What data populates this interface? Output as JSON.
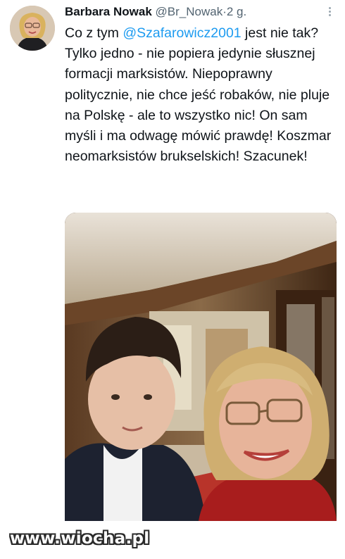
{
  "tweet": {
    "author_name": "Barbara Nowak",
    "handle": "@Br_Nowak",
    "separator": "·",
    "time": "2 g.",
    "text_prefix": "Co z tym ",
    "mention": "@Szafarowicz2001",
    "text_suffix": " jest nie tak? Tylko jedno - nie popiera jedynie słusznej formacji marksistów. Niepoprawny politycznie, nie chce jeść robaków, nie pluje na Polskę - ale to wszystko nic! On sam myśli i ma odwagę mówić prawdę! Koszmar neomarksistów brukselskich! Szacunek!"
  },
  "icons": {
    "more": "more-options-icon"
  },
  "watermark": "www.wiocha.pl",
  "colors": {
    "link": "#1d9bf0",
    "text": "#0f1419",
    "secondary": "#536471"
  }
}
